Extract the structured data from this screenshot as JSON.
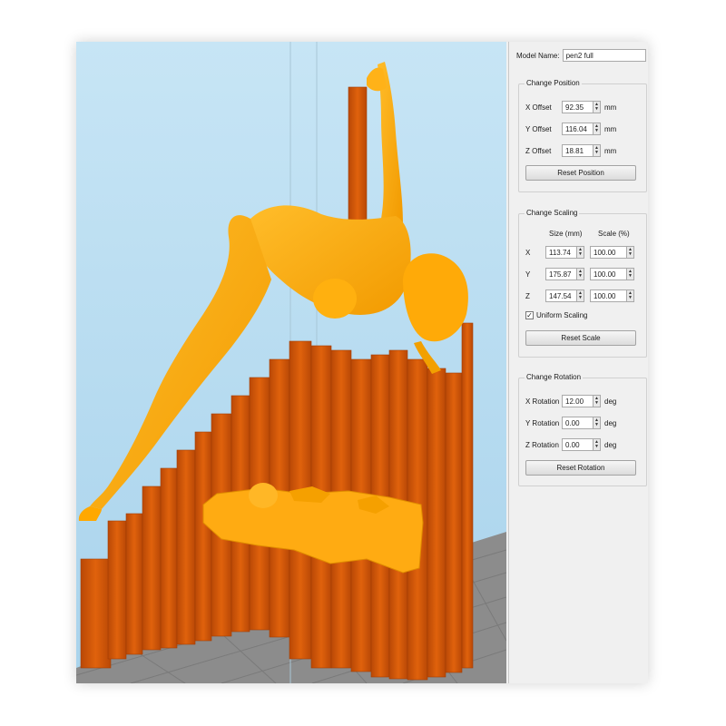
{
  "model_name": {
    "label": "Model Name:",
    "value": "pen2 full"
  },
  "position": {
    "title": "Change Position",
    "fields": [
      {
        "label": "X Offset",
        "value": "92.35",
        "unit": "mm"
      },
      {
        "label": "Y Offset",
        "value": "116.04",
        "unit": "mm"
      },
      {
        "label": "Z Offset",
        "value": "18.81",
        "unit": "mm"
      }
    ],
    "reset_label": "Reset Position"
  },
  "scaling": {
    "title": "Change Scaling",
    "size_header": "Size (mm)",
    "scale_header": "Scale (%)",
    "rows": [
      {
        "axis": "X",
        "size": "113.74",
        "scale": "100.00"
      },
      {
        "axis": "Y",
        "size": "175.87",
        "scale": "100.00"
      },
      {
        "axis": "Z",
        "size": "147.54",
        "scale": "100.00"
      }
    ],
    "uniform_label": "Uniform Scaling",
    "uniform_checked": true,
    "reset_label": "Reset Scale"
  },
  "rotation": {
    "title": "Change Rotation",
    "fields": [
      {
        "label": "X Rotation",
        "value": "12.00",
        "unit": "deg"
      },
      {
        "label": "Y Rotation",
        "value": "0.00",
        "unit": "deg"
      },
      {
        "label": "Z Rotation",
        "value": "0.00",
        "unit": "deg"
      }
    ],
    "reset_label": "Reset Rotation"
  },
  "colors": {
    "sky": "#bfe0f2",
    "model": "#ffaa00",
    "supports": "#d95a08",
    "bed": "#8e8e8e"
  }
}
